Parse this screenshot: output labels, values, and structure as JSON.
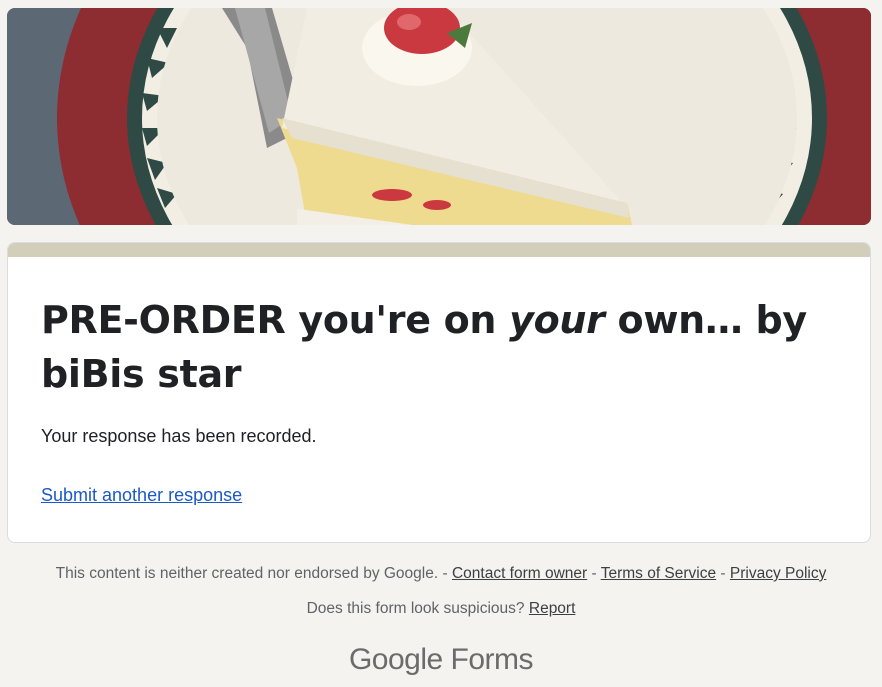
{
  "header_image": {
    "alt": "Slice of strawberry cake on a plate",
    "colors": {
      "table": "#6c7784",
      "plate_rim": "#8d2d32",
      "plate": "#eee9df",
      "frosting": "#f1ede2",
      "sponge": "#eedb8f",
      "strawberry": "#c9393f"
    }
  },
  "form": {
    "accent_color": "#d3ceb9",
    "title_part1": "PRE-ORDER you're on ",
    "title_em": "your",
    "title_part2": " own… by biBis star",
    "confirmation": "Your response has been recorded.",
    "submit_another": "Submit another response"
  },
  "footer": {
    "disclaimer": "This content is neither created nor endorsed by Google.",
    "sep": " - ",
    "contact_owner": "Contact form owner",
    "terms": "Terms of Service",
    "privacy": "Privacy Policy",
    "suspicious": "Does this form look suspicious?",
    "report": "Report",
    "brand_google": "Google",
    "brand_forms": "Forms"
  }
}
